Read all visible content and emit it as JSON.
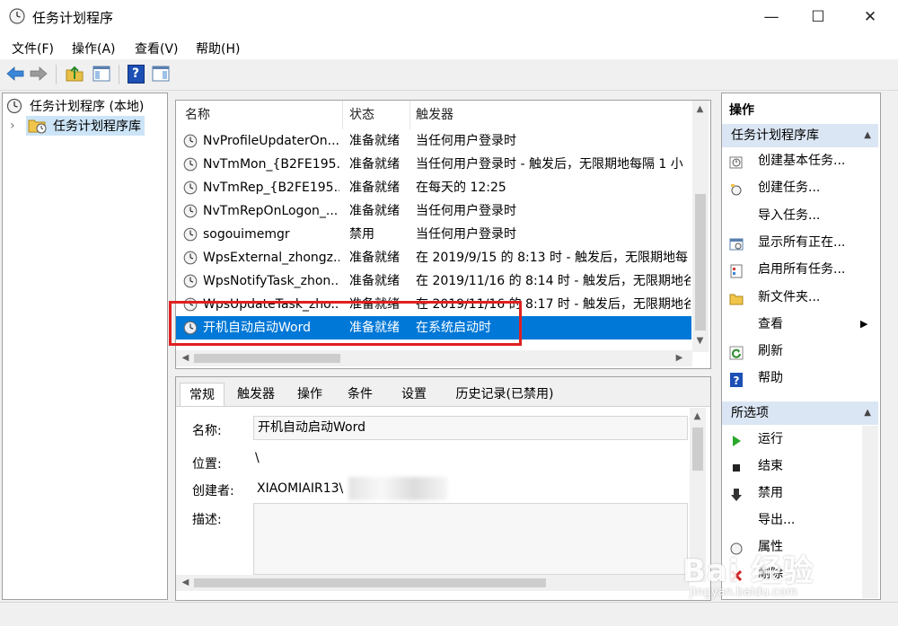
{
  "window": {
    "title": "任务计划程序",
    "minimize": "—",
    "maximize": "☐",
    "close": "✕"
  },
  "menu": [
    "文件(F)",
    "操作(A)",
    "查看(V)",
    "帮助(H)"
  ],
  "toolbar": {
    "help_glyph": "?"
  },
  "tree": {
    "root": "任务计划程序 (本地)",
    "library": "任务计划程序库",
    "expander": "›"
  },
  "list": {
    "columns": [
      "名称",
      "状态",
      "触发器"
    ],
    "rows": [
      {
        "name": "NvProfileUpdaterOn...",
        "status": "准备就绪",
        "trigger": "当任何用户登录时"
      },
      {
        "name": "NvTmMon_{B2FE195...",
        "status": "准备就绪",
        "trigger": "当任何用户登录时 - 触发后，无限期地每隔 1 小"
      },
      {
        "name": "NvTmRep_{B2FE195...",
        "status": "准备就绪",
        "trigger": "在每天的 12:25"
      },
      {
        "name": "NvTmRepOnLogon_...",
        "status": "准备就绪",
        "trigger": "当任何用户登录时"
      },
      {
        "name": "sogouimemgr",
        "status": "禁用",
        "trigger": "当任何用户登录时"
      },
      {
        "name": "WpsExternal_zhongz...",
        "status": "准备就绪",
        "trigger": "在 2019/9/15 的 8:13 时 - 触发后，无限期地每"
      },
      {
        "name": "WpsNotifyTask_zhon...",
        "status": "准备就绪",
        "trigger": "在 2019/11/16 的 8:14 时 - 触发后，无限期地谷"
      },
      {
        "name": "WpsUpdateTask_zho...",
        "status": "准备就绪",
        "trigger": "在 2019/11/16 的 8:17 时 - 触发后，无限期地谷"
      },
      {
        "name": "开机自动启动Word",
        "status": "准备就绪",
        "trigger": "在系统启动时",
        "selected": true
      }
    ]
  },
  "detail": {
    "tabs": [
      "常规",
      "触发器",
      "操作",
      "条件",
      "设置",
      "历史记录(已禁用)"
    ],
    "name_label": "名称:",
    "name_value": "开机自动启动Word",
    "location_label": "位置:",
    "location_value": "\\",
    "author_label": "创建者:",
    "author_value": "XIAOMIAIR13\\",
    "desc_label": "描述:"
  },
  "actions": {
    "title": "操作",
    "section1": "任务计划程序库",
    "items1": [
      {
        "label": "创建基本任务...",
        "icon": "create-basic-task-icon"
      },
      {
        "label": "创建任务...",
        "icon": "create-task-icon"
      },
      {
        "label": "导入任务...",
        "icon": ""
      },
      {
        "label": "显示所有正在...",
        "icon": "running-tasks-icon"
      },
      {
        "label": "启用所有任务...",
        "icon": "history-icon"
      },
      {
        "label": "新文件夹...",
        "icon": "folder-icon"
      },
      {
        "label": "查看",
        "icon": ""
      },
      {
        "label": "刷新",
        "icon": "refresh-icon"
      },
      {
        "label": "帮助",
        "icon": "help-icon"
      }
    ],
    "section2": "所选项",
    "items2": [
      {
        "label": "运行",
        "icon": "run-icon"
      },
      {
        "label": "结束",
        "icon": "stop-icon"
      },
      {
        "label": "禁用",
        "icon": "disable-icon"
      },
      {
        "label": "导出...",
        "icon": ""
      },
      {
        "label": "属性",
        "icon": "properties-icon"
      },
      {
        "label": "删除",
        "icon": "delete-icon"
      }
    ]
  },
  "watermark": {
    "text": "Bai 经验",
    "url": "jingyan.baidu.com"
  },
  "colors": {
    "selection": "#0078d7",
    "section_header": "#dbe6f4",
    "highlight": "#e02020"
  }
}
